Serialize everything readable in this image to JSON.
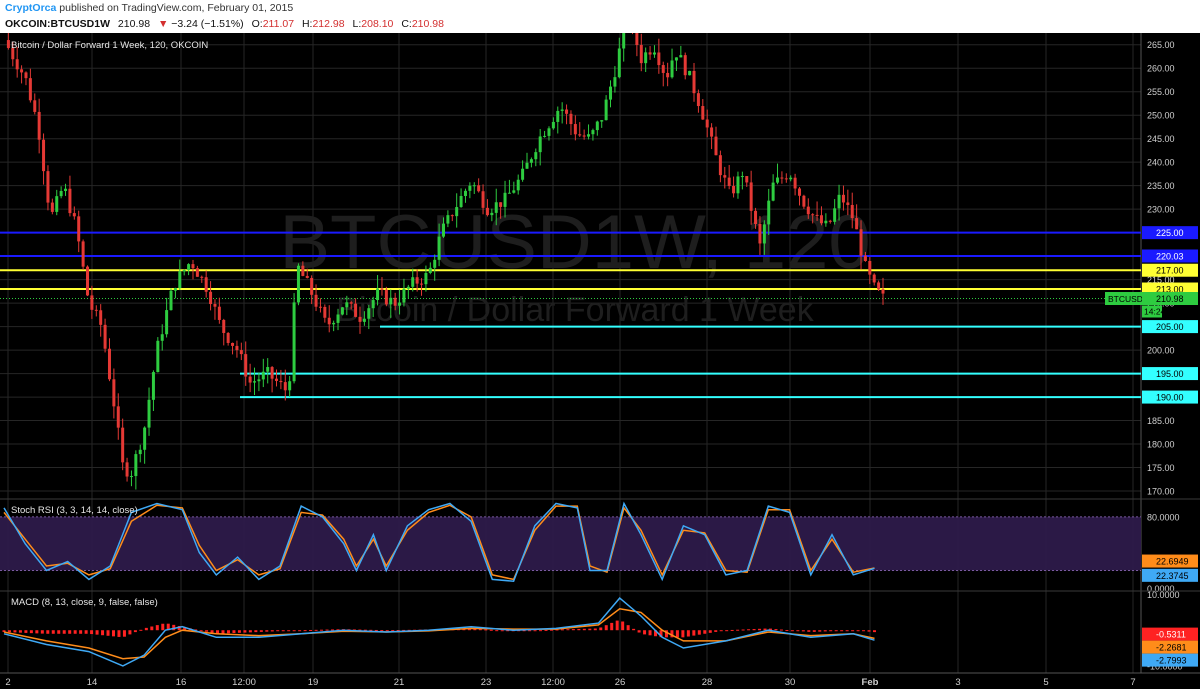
{
  "header": {
    "author": "CryptOrca",
    "published_text": "published on TradingView.com, February 01, 2015",
    "symbol": "OKCOIN:BTCUSD1W",
    "last": "210.98",
    "change_arrow": "▼",
    "change": "−3.24 (−1.51%)",
    "open_label": "O:",
    "open": "211.07",
    "high_label": "H:",
    "high": "212.98",
    "low_label": "L:",
    "low": "208.10",
    "close_label": "C:",
    "close": "210.98"
  },
  "colors": {
    "background": "#000000",
    "grid": "#262626",
    "up_candle": "#2ecc40",
    "down_candle": "#e53935",
    "blue_line": "#1a1aff",
    "yellow_line": "#ffff33",
    "cyan_line": "#33ffff",
    "stoch_k": "#3fa9f5",
    "stoch_d": "#ff8c1a",
    "macd_line": "#3fa9f5",
    "signal_line": "#ff8c1a",
    "hist_up": "#ff2222",
    "rsi_band": "#2d1a4a"
  },
  "chart_data": {
    "type": "candlestick",
    "main_title": "Bitcoin / Dollar Forward 1 Week, 120, OKCOIN",
    "watermark_symbol": "BTCUSD1W, 120",
    "watermark_name": "Bitcoin / Dollar Forward 1 Week",
    "price_axis": {
      "ticks": [
        265,
        260,
        255,
        250,
        245,
        240,
        235,
        230,
        225,
        220,
        215,
        210,
        205,
        200,
        195,
        190,
        185,
        180,
        175,
        170
      ],
      "tick_labels": [
        "265.00",
        "260.00",
        "255.00",
        "250.00",
        "245.00",
        "240.00",
        "235.00",
        "230.00",
        "225.00",
        "220.00",
        "215.00",
        "210.00",
        "205.00",
        "200.00",
        "195.00",
        "190.00",
        "185.00",
        "180.00",
        "175.00",
        "170.00"
      ],
      "range": [
        168.3,
        267.5
      ]
    },
    "x_axis": {
      "tick_labels": [
        "2",
        "14",
        "16",
        "12:00",
        "19",
        "21",
        "23",
        "12:00",
        "26",
        "28",
        "30",
        "Feb",
        "3",
        "5",
        "7"
      ]
    },
    "levels": [
      {
        "value": 225.0,
        "label": "225.00",
        "color": "#1a1aff"
      },
      {
        "value": 220.03,
        "label": "220.03",
        "color": "#1a1aff"
      },
      {
        "value": 217.0,
        "label": "217.00",
        "color": "#ffff33"
      },
      {
        "value": 213.0,
        "label": "213.00",
        "color": "#ffff33"
      },
      {
        "value": 205.0,
        "label": "205.00",
        "color": "#33ffff"
      },
      {
        "value": 195.0,
        "label": "195.00",
        "color": "#33ffff"
      },
      {
        "value": 190.0,
        "label": "190.00",
        "color": "#33ffff"
      }
    ],
    "last_price": {
      "value": 210.98,
      "label": "210.98",
      "symbol_tag": "BTCUSD1W",
      "countdown": "14:24"
    },
    "price_path": [
      [
        0,
        266
      ],
      [
        0.05,
        258
      ],
      [
        0.08,
        248
      ],
      [
        0.11,
        228
      ],
      [
        0.14,
        235
      ],
      [
        0.17,
        226
      ],
      [
        0.2,
        210
      ],
      [
        0.23,
        205
      ],
      [
        0.26,
        188
      ],
      [
        0.28,
        175
      ],
      [
        0.3,
        174
      ],
      [
        0.33,
        183
      ],
      [
        0.36,
        200
      ],
      [
        0.4,
        214
      ],
      [
        0.44,
        219
      ],
      [
        0.48,
        213
      ],
      [
        0.51,
        205
      ],
      [
        0.55,
        200
      ],
      [
        0.58,
        193
      ],
      [
        0.62,
        195
      ],
      [
        0.67,
        191
      ],
      [
        0.69,
        218
      ],
      [
        0.72,
        213
      ],
      [
        0.76,
        205
      ],
      [
        0.8,
        210
      ],
      [
        0.84,
        207
      ],
      [
        0.88,
        212
      ],
      [
        0.92,
        210
      ],
      [
        0.96,
        214
      ],
      [
        1.0,
        216
      ],
      [
        1.03,
        225
      ],
      [
        1.06,
        230
      ],
      [
        1.1,
        236
      ],
      [
        1.14,
        230
      ],
      [
        1.18,
        232
      ],
      [
        1.22,
        237
      ],
      [
        1.26,
        245
      ],
      [
        1.31,
        252
      ],
      [
        1.35,
        246
      ],
      [
        1.38,
        245
      ],
      [
        1.41,
        250
      ],
      [
        1.44,
        260
      ],
      [
        1.47,
        272
      ],
      [
        1.5,
        262
      ],
      [
        1.53,
        265
      ],
      [
        1.56,
        258
      ],
      [
        1.58,
        264
      ],
      [
        1.61,
        259
      ],
      [
        1.64,
        252
      ],
      [
        1.68,
        240
      ],
      [
        1.71,
        233
      ],
      [
        1.74,
        238
      ],
      [
        1.78,
        222
      ],
      [
        1.81,
        235
      ],
      [
        1.85,
        238
      ],
      [
        1.88,
        232
      ],
      [
        1.91,
        228
      ],
      [
        1.94,
        226
      ],
      [
        1.97,
        233
      ],
      [
        2.0,
        228
      ],
      [
        2.03,
        217
      ],
      [
        2.05,
        213
      ],
      [
        2.07,
        211
      ]
    ],
    "stoch_rsi": {
      "title": "Stoch RSI (3, 3, 14, 14, close)",
      "levels": [
        80,
        20
      ],
      "axis_ticks": [
        "80.0000",
        "0.0000"
      ],
      "axis_values": [
        80,
        0
      ],
      "range": [
        -3,
        100
      ],
      "k_value": 22.3745,
      "k_label": "22.3745",
      "d_value": 22.6949,
      "d_label": "22.6949",
      "k_path": [
        [
          0,
          90
        ],
        [
          0.05,
          50
        ],
        [
          0.1,
          20
        ],
        [
          0.15,
          30
        ],
        [
          0.2,
          10
        ],
        [
          0.25,
          25
        ],
        [
          0.3,
          85
        ],
        [
          0.36,
          95
        ],
        [
          0.42,
          88
        ],
        [
          0.46,
          40
        ],
        [
          0.5,
          15
        ],
        [
          0.55,
          35
        ],
        [
          0.6,
          10
        ],
        [
          0.65,
          25
        ],
        [
          0.7,
          92
        ],
        [
          0.75,
          80
        ],
        [
          0.8,
          50
        ],
        [
          0.83,
          20
        ],
        [
          0.87,
          60
        ],
        [
          0.9,
          20
        ],
        [
          0.95,
          70
        ],
        [
          1.0,
          88
        ],
        [
          1.05,
          95
        ],
        [
          1.1,
          75
        ],
        [
          1.15,
          10
        ],
        [
          1.2,
          8
        ],
        [
          1.25,
          70
        ],
        [
          1.3,
          95
        ],
        [
          1.35,
          90
        ],
        [
          1.38,
          20
        ],
        [
          1.42,
          20
        ],
        [
          1.46,
          95
        ],
        [
          1.5,
          60
        ],
        [
          1.55,
          10
        ],
        [
          1.6,
          70
        ],
        [
          1.65,
          60
        ],
        [
          1.7,
          15
        ],
        [
          1.75,
          20
        ],
        [
          1.8,
          92
        ],
        [
          1.85,
          85
        ],
        [
          1.9,
          15
        ],
        [
          1.95,
          60
        ],
        [
          2.0,
          15
        ],
        [
          2.05,
          22.4
        ]
      ],
      "d_path": [
        [
          0,
          85
        ],
        [
          0.05,
          55
        ],
        [
          0.1,
          25
        ],
        [
          0.15,
          28
        ],
        [
          0.2,
          15
        ],
        [
          0.25,
          22
        ],
        [
          0.3,
          75
        ],
        [
          0.36,
          93
        ],
        [
          0.42,
          90
        ],
        [
          0.46,
          48
        ],
        [
          0.5,
          20
        ],
        [
          0.55,
          32
        ],
        [
          0.6,
          15
        ],
        [
          0.65,
          22
        ],
        [
          0.7,
          85
        ],
        [
          0.75,
          82
        ],
        [
          0.8,
          55
        ],
        [
          0.83,
          25
        ],
        [
          0.87,
          55
        ],
        [
          0.9,
          25
        ],
        [
          0.95,
          65
        ],
        [
          1.0,
          85
        ],
        [
          1.05,
          93
        ],
        [
          1.1,
          80
        ],
        [
          1.15,
          15
        ],
        [
          1.2,
          10
        ],
        [
          1.25,
          65
        ],
        [
          1.3,
          92
        ],
        [
          1.35,
          92
        ],
        [
          1.38,
          25
        ],
        [
          1.42,
          18
        ],
        [
          1.46,
          90
        ],
        [
          1.5,
          65
        ],
        [
          1.55,
          15
        ],
        [
          1.6,
          65
        ],
        [
          1.65,
          62
        ],
        [
          1.7,
          20
        ],
        [
          1.75,
          18
        ],
        [
          1.8,
          88
        ],
        [
          1.85,
          88
        ],
        [
          1.9,
          20
        ],
        [
          1.95,
          55
        ],
        [
          2.0,
          18
        ],
        [
          2.05,
          22.7
        ]
      ]
    },
    "macd": {
      "title": "MACD (8, 13, close, 9, false, false)",
      "axis_ticks": [
        "10.0000",
        "-10.0000"
      ],
      "axis_values": [
        10,
        -10
      ],
      "range": [
        -12,
        11
      ],
      "hist_value": -0.5311,
      "hist_label": "-0.5311",
      "signal_value": -2.2681,
      "signal_label": "-2.2681",
      "macd_value": -2.7993,
      "macd_label": "-2.7993",
      "macd_path": [
        [
          0,
          -1
        ],
        [
          0.1,
          -4
        ],
        [
          0.2,
          -6
        ],
        [
          0.28,
          -10
        ],
        [
          0.33,
          -7
        ],
        [
          0.38,
          0
        ],
        [
          0.42,
          1
        ],
        [
          0.5,
          -2
        ],
        [
          0.6,
          -2
        ],
        [
          0.7,
          -1
        ],
        [
          0.8,
          0
        ],
        [
          0.9,
          -0.5
        ],
        [
          1.0,
          0
        ],
        [
          1.1,
          1
        ],
        [
          1.2,
          0
        ],
        [
          1.3,
          0.5
        ],
        [
          1.4,
          2
        ],
        [
          1.45,
          9
        ],
        [
          1.5,
          4
        ],
        [
          1.55,
          -2
        ],
        [
          1.6,
          -5
        ],
        [
          1.7,
          -3
        ],
        [
          1.8,
          0
        ],
        [
          1.9,
          -2
        ],
        [
          2.0,
          -1
        ],
        [
          2.05,
          -2.8
        ]
      ],
      "signal_path": [
        [
          0,
          -0.5
        ],
        [
          0.1,
          -3
        ],
        [
          0.2,
          -5
        ],
        [
          0.28,
          -8
        ],
        [
          0.33,
          -7.5
        ],
        [
          0.38,
          -2
        ],
        [
          0.42,
          0
        ],
        [
          0.5,
          -1
        ],
        [
          0.6,
          -1.5
        ],
        [
          0.7,
          -1
        ],
        [
          0.8,
          -0.3
        ],
        [
          0.9,
          -0.5
        ],
        [
          1.0,
          -0.2
        ],
        [
          1.1,
          0.5
        ],
        [
          1.2,
          0.3
        ],
        [
          1.3,
          0.3
        ],
        [
          1.4,
          1.5
        ],
        [
          1.45,
          6
        ],
        [
          1.5,
          5
        ],
        [
          1.55,
          0
        ],
        [
          1.6,
          -3
        ],
        [
          1.7,
          -3
        ],
        [
          1.8,
          -0.5
        ],
        [
          1.9,
          -1.5
        ],
        [
          2.0,
          -1
        ],
        [
          2.05,
          -2.3
        ]
      ],
      "hist_path": [
        [
          0,
          -0.5
        ],
        [
          0.1,
          -1
        ],
        [
          0.2,
          -1
        ],
        [
          0.28,
          -2
        ],
        [
          0.33,
          0.5
        ],
        [
          0.38,
          2
        ],
        [
          0.42,
          1
        ],
        [
          0.5,
          -1
        ],
        [
          0.6,
          -0.5
        ],
        [
          0.7,
          0
        ],
        [
          0.8,
          0.3
        ],
        [
          0.9,
          0
        ],
        [
          1.0,
          0.2
        ],
        [
          1.1,
          0.5
        ],
        [
          1.2,
          -0.3
        ],
        [
          1.3,
          0.2
        ],
        [
          1.4,
          0.5
        ],
        [
          1.45,
          3
        ],
        [
          1.5,
          -1
        ],
        [
          1.55,
          -2
        ],
        [
          1.6,
          -2
        ],
        [
          1.7,
          0
        ],
        [
          1.8,
          0.5
        ],
        [
          1.9,
          -0.5
        ],
        [
          2.0,
          0
        ],
        [
          2.05,
          -0.53
        ]
      ]
    }
  }
}
